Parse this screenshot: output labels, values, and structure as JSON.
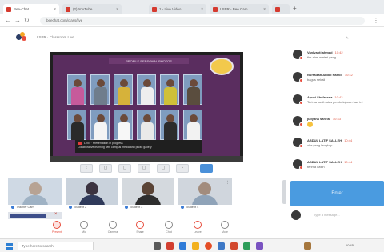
{
  "browser": {
    "tabs": [
      {
        "label": "Bee-Chat"
      },
      {
        "label": "(2) YouTube"
      },
      {
        "label": "1 - Live Video"
      },
      {
        "label": "LSPR - Bee Cam"
      },
      {
        "label": "Bee Chat"
      }
    ],
    "new_tab": "+",
    "url": "beechat.com/class/live"
  },
  "class_header": {
    "name": "LSPR · Classroom Live"
  },
  "slide": {
    "title": "PROFILE PERSONAL PHOTOS",
    "caption_line1": "LIVE · Presentation in progress",
    "caption_line2": "Collaborative learning with campus media and photo gallery"
  },
  "participants": [
    {
      "name": "Teacher Cam"
    },
    {
      "name": "Student 2"
    },
    {
      "name": "Student 3"
    },
    {
      "name": "Student 4"
    }
  ],
  "controls": [
    {
      "label": "Present",
      "icon": "present-icon"
    },
    {
      "label": "Mic",
      "icon": "mic-icon"
    },
    {
      "label": "Camera",
      "icon": "camera-icon"
    },
    {
      "label": "Share",
      "icon": "share-icon"
    },
    {
      "label": "Chat",
      "icon": "chat-icon"
    },
    {
      "label": "Leave",
      "icon": "leave-icon"
    },
    {
      "label": "More",
      "icon": "more-icon"
    }
  ],
  "chat": {
    "top_action": "edit",
    "messages": [
      {
        "name": "Vanlyanti ahmad",
        "time": "10:42",
        "text": "thx atas materi yang"
      },
      {
        "name": "Nurfaizah Abdul Hamid",
        "time": "10:42",
        "text": "bagus sekali"
      },
      {
        "name": "Ayuni Shafreena",
        "time": "10:43",
        "text": "Terima kasih atas pembelajaran hari ini"
      },
      {
        "name": "juliyana sahrial",
        "time": "10:43",
        "text": ""
      },
      {
        "name": "ABDUL LATIF SALLEH",
        "time": "10:44",
        "text": "oke yang lengkap"
      },
      {
        "name": "ABDUL LATIF SALLEH",
        "time": "10:44",
        "text": "terima kasih"
      }
    ],
    "join_label": "Enter",
    "input_placeholder": "Type a message..."
  },
  "taskbar": {
    "search_placeholder": "Type here to search",
    "time": "10:45"
  }
}
